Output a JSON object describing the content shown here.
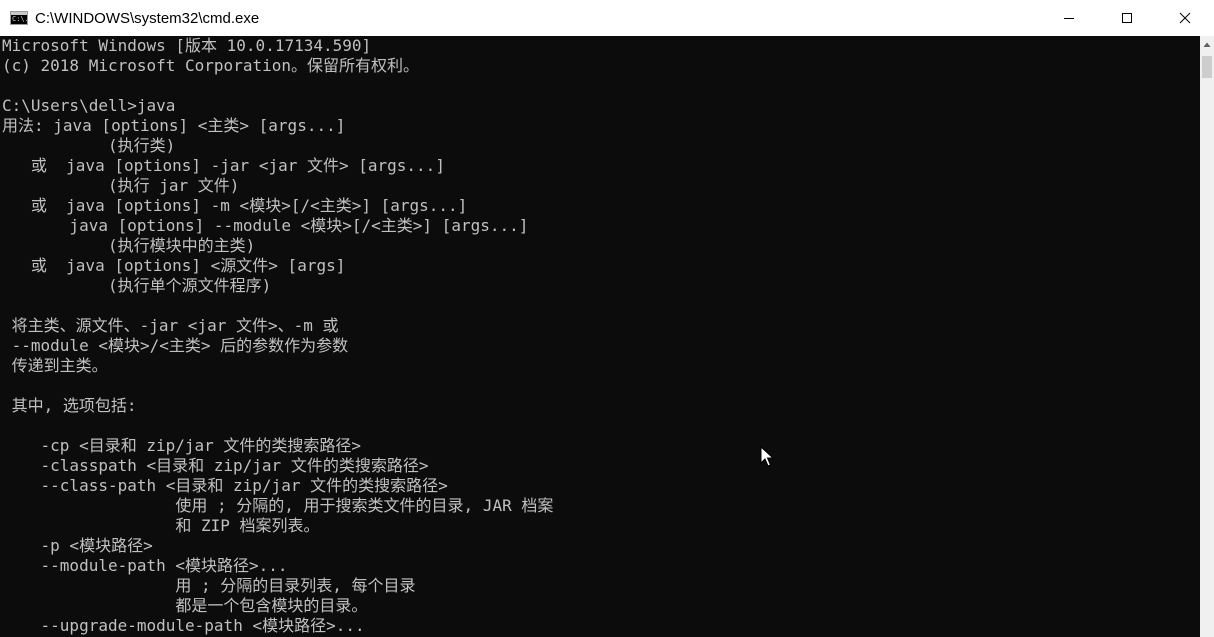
{
  "window": {
    "title": "C:\\WINDOWS\\system32\\cmd.exe",
    "icon": "cmd-icon",
    "icon_text": "C:\\."
  },
  "controls": {
    "minimize_icon": "minimize-icon",
    "maximize_icon": "maximize-icon",
    "close_icon": "close-icon"
  },
  "console": {
    "background": "#0c0c0c",
    "foreground": "#c0c0c0",
    "lines": [
      "Microsoft Windows [版本 10.0.17134.590]",
      "(c) 2018 Microsoft Corporation。保留所有权利。",
      "",
      "C:\\Users\\dell>java",
      "用法: java [options] <主类> [args...]",
      "           (执行类)",
      "   或  java [options] -jar <jar 文件> [args...]",
      "           (执行 jar 文件)",
      "   或  java [options] -m <模块>[/<主类>] [args...]",
      "       java [options] --module <模块>[/<主类>] [args...]",
      "           (执行模块中的主类)",
      "   或  java [options] <源文件> [args]",
      "           (执行单个源文件程序)",
      "",
      " 将主类、源文件、-jar <jar 文件>、-m 或",
      " --module <模块>/<主类> 后的参数作为参数",
      " 传递到主类。",
      "",
      " 其中, 选项包括:",
      "",
      "    -cp <目录和 zip/jar 文件的类搜索路径>",
      "    -classpath <目录和 zip/jar 文件的类搜索路径>",
      "    --class-path <目录和 zip/jar 文件的类搜索路径>",
      "                  使用 ; 分隔的, 用于搜索类文件的目录, JAR 档案",
      "                  和 ZIP 档案列表。",
      "    -p <模块路径>",
      "    --module-path <模块路径>...",
      "                  用 ; 分隔的目录列表, 每个目录",
      "                  都是一个包含模块的目录。",
      "    --upgrade-module-path <模块路径>..."
    ]
  },
  "scrollbar": {
    "up_icon": "scroll-up-arrow-icon"
  },
  "pointer": {
    "icon": "mouse-cursor-icon"
  }
}
